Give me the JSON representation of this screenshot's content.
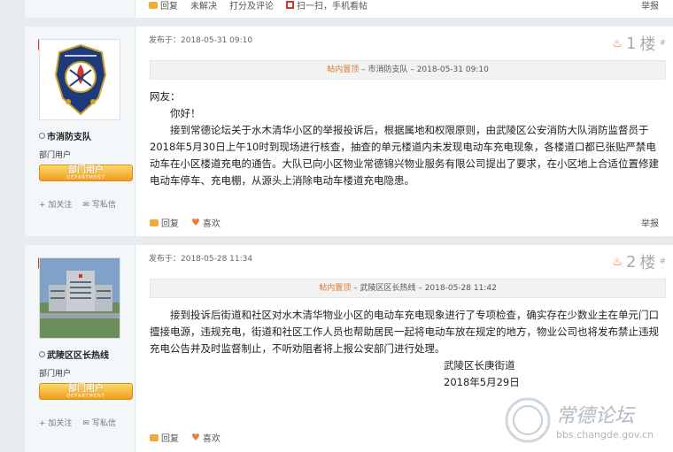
{
  "top_strip": {
    "reply": "回复",
    "unsolved": "未解决",
    "rate": "打分及评论",
    "scan": "扫一扫，手机看帖",
    "report": "举报"
  },
  "posts": [
    {
      "user": {
        "name": "市消防支队",
        "group": "部门用户",
        "dept_badge": "部门用户",
        "dept_badge_sub": "DEPARTMENT",
        "follow": "加关注",
        "message": "写私信"
      },
      "posted_label": "发布于：2018-05-31 09:10",
      "floor_num": "1",
      "floor_unit": "楼",
      "floor_sup": "#",
      "pin": {
        "label": "帖内置顶",
        "author": "市消防支队",
        "time": "2018-05-31 09:10"
      },
      "body": [
        "网友：",
        "你好！",
        "接到常德论坛关于水木清华小区的举报投诉后，根据属地和权限原则，由武陵区公安消防大队消防监督员于2018年5月30日上午10时到现场进行核查，抽查的单元楼道内未发现电动车充电现象，各楼道口都已张贴严禁电动车在小区楼道充电的通告。大队已向小区物业常德锦兴物业服务有限公司提出了要求，在小区地上合适位置修建电动车停车、充电棚，从源头上消除电动车楼道充电隐患。"
      ],
      "actions": {
        "reply": "回复",
        "like": "喜欢",
        "report": "举报"
      }
    },
    {
      "user": {
        "name": "武陵区区长热线",
        "group": "部门用户",
        "dept_badge": "部门用户",
        "dept_badge_sub": "DEPARTMENT",
        "follow": "加关注",
        "message": "写私信"
      },
      "posted_label": "发布于：2018-05-28 11:34",
      "floor_num": "2",
      "floor_unit": "楼",
      "floor_sup": "#",
      "pin": {
        "label": "帖内置顶",
        "author": "武陵区区长热线",
        "time": "2018-05-28 11:42"
      },
      "body": [
        "接到投诉后街道和社区对水木清华物业小区的电动车充电现象进行了专项检查，确实存在少数业主在单元门口擅接电源，违规充电，街道和社区工作人员也帮助居民一起将电动车放在规定的地方，物业公司也将发布禁止违规充电公告并及时监督制止，不听劝阻者将上报公安部门进行处理。",
        "武陵区长庚街道",
        "2018年5月29日"
      ],
      "actions": {
        "reply": "回复",
        "like": "喜欢"
      }
    }
  ],
  "watermark": {
    "name": "常德论坛",
    "url": "bbs.changde.gov.cn"
  }
}
